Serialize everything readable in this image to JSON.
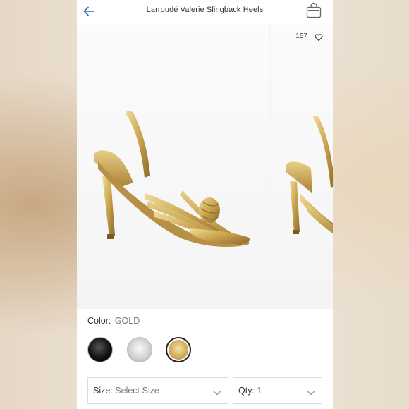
{
  "header": {
    "title": "Larroudé Valerie Slingback Heels",
    "back_icon": "back-arrow-icon",
    "bag_icon": "shopping-bag-icon"
  },
  "gallery": {
    "likes": "157",
    "like_icon": "heart-icon"
  },
  "color": {
    "label": "Color:",
    "value": "GOLD",
    "swatches": [
      {
        "name": "black",
        "color": "#111111",
        "selected": false
      },
      {
        "name": "silver",
        "color": "#cfcfcf",
        "selected": false
      },
      {
        "name": "gold",
        "color": "#c9a24c",
        "selected": true
      }
    ]
  },
  "size": {
    "label": "Size:",
    "value": "Select Size"
  },
  "qty": {
    "label": "Qty:",
    "value": "1"
  },
  "colors": {
    "accent_blue": "#2f6fa8",
    "gold": "#c9a24c"
  }
}
